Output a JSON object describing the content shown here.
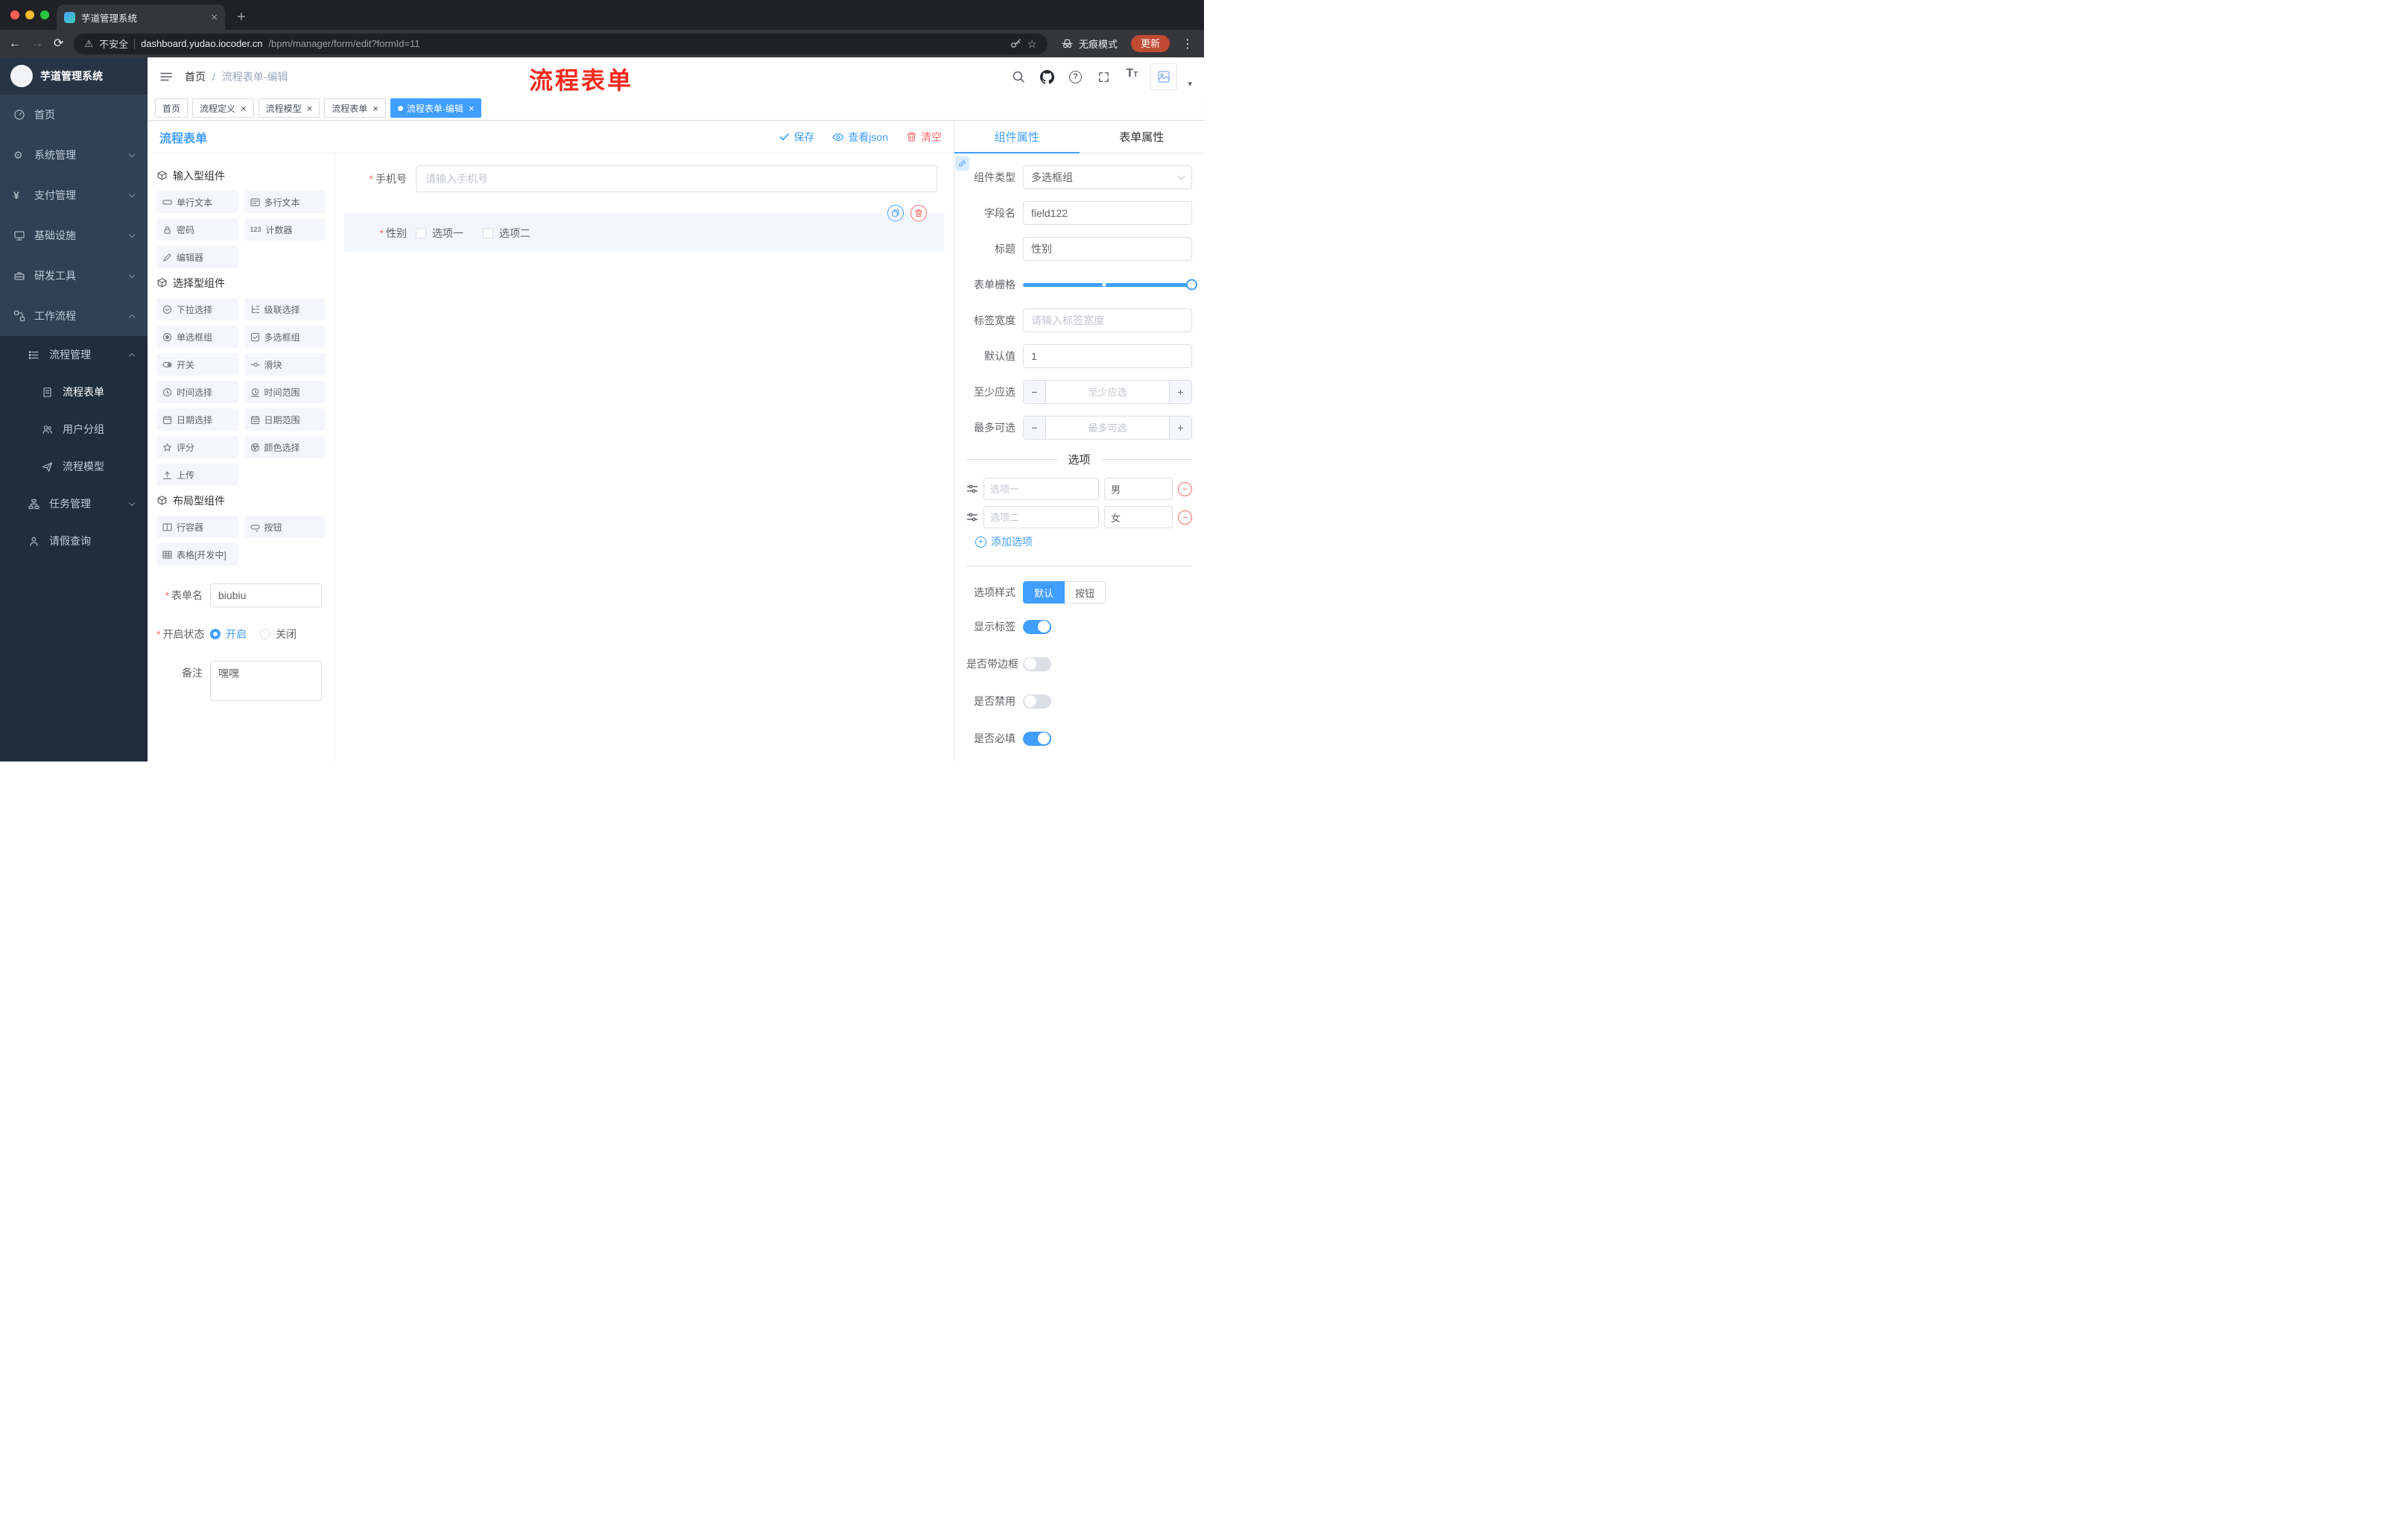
{
  "colors": {
    "accent": "#409eff",
    "danger": "#f56c6c",
    "sidebar_bg": "#304156",
    "sidebar_submenu_bg": "#1f2d3d",
    "active_tag_bg": "#409eff",
    "update_chip_bg": "#bf4932",
    "annotation_red": "#f5291d",
    "selected_widget_bg": "#f4f6fe"
  },
  "icons": {
    "warning": "⚠",
    "star": "☆",
    "kebab": "⋮",
    "gear": "⚙",
    "yen": "¥",
    "plus": "+",
    "close": "×",
    "minus": "−",
    "caret_down": "▾",
    "question": "?",
    "font_big": "T",
    "font_small": "T",
    "counter_123": "123"
  },
  "annotation": {
    "overlay_text": "流程表单"
  },
  "browser": {
    "tab": {
      "title": "芋道管理系统",
      "close": "×",
      "new_tab": "+"
    },
    "nav": {
      "back": "←",
      "forward": "→",
      "reload": "⟳"
    },
    "address": {
      "security": "不安全",
      "host": "dashboard.yudao.iocoder.cn",
      "path": "/bpm/manager/form/edit?formId=11"
    },
    "incognito_label": "无痕模式",
    "update_label": "更新"
  },
  "sidebar": {
    "logo_title": "芋道管理系统",
    "menu": [
      {
        "label": "首页"
      },
      {
        "label": "系统管理"
      },
      {
        "label": "支付管理"
      },
      {
        "label": "基础设施"
      },
      {
        "label": "研发工具"
      },
      {
        "label": "工作流程"
      },
      {
        "label": "流程管理"
      },
      {
        "label": "流程表单"
      },
      {
        "label": "用户分组"
      },
      {
        "label": "流程模型"
      },
      {
        "label": "任务管理"
      },
      {
        "label": "请假查询"
      }
    ]
  },
  "navbar": {
    "breadcrumb_home": "首页",
    "breadcrumb_separator": "/",
    "breadcrumb_current": "流程表单-编辑"
  },
  "tags": [
    {
      "label": "首页",
      "closable": false,
      "active": false
    },
    {
      "label": "流程定义",
      "closable": true,
      "active": false
    },
    {
      "label": "流程模型",
      "closable": true,
      "active": false
    },
    {
      "label": "流程表单",
      "closable": true,
      "active": false
    },
    {
      "label": "流程表单-编辑",
      "closable": true,
      "active": true
    }
  ],
  "editor": {
    "title": "流程表单",
    "actions": {
      "save": "保存",
      "view_json": "查看json",
      "clear": "清空"
    }
  },
  "components": {
    "groups": [
      {
        "title": "输入型组件",
        "items": [
          "单行文本",
          "多行文本",
          "密码",
          "计数器",
          "编辑器"
        ]
      },
      {
        "title": "选择型组件",
        "items": [
          "下拉选择",
          "级联选择",
          "单选框组",
          "多选框组",
          "开关",
          "滑块",
          "时间选择",
          "时间范围",
          "日期选择",
          "日期范围",
          "评分",
          "颜色选择",
          "上传"
        ]
      },
      {
        "title": "布局型组件",
        "items": [
          "行容器",
          "按钮",
          "表格[开发中]"
        ]
      }
    ],
    "meta": {
      "form_name_label": "表单名",
      "form_name_value": "biubiu",
      "status_label": "开启状态",
      "status_on": "开启",
      "status_off": "关闭",
      "status_selected": "开启",
      "remark_label": "备注",
      "remark_value": "嘿嘿"
    }
  },
  "canvas": {
    "phone": {
      "label": "手机号",
      "required": true,
      "placeholder": "请输入手机号"
    },
    "gender": {
      "label": "性别",
      "required": true,
      "selected": true,
      "option1": "选项一",
      "option2": "选项二"
    }
  },
  "props": {
    "tab_component": "组件属性",
    "tab_form": "表单属性",
    "fields": {
      "component_type": {
        "label": "组件类型",
        "value": "多选框组"
      },
      "field_name": {
        "label": "字段名",
        "value": "field122"
      },
      "title": {
        "label": "标题",
        "value": "性别"
      },
      "grid": {
        "label": "表单栅格"
      },
      "label_width": {
        "label": "标签宽度",
        "placeholder": "请输入标签宽度"
      },
      "default_value": {
        "label": "默认值",
        "value": "1"
      },
      "min_select": {
        "label": "至少应选",
        "placeholder": "至少应选"
      },
      "max_select": {
        "label": "最多可选",
        "placeholder": "最多可选"
      }
    },
    "options": {
      "title": "选项",
      "rows": [
        {
          "name_placeholder": "选项一",
          "value": "男"
        },
        {
          "name_placeholder": "选项二",
          "value": "女"
        }
      ],
      "add_label": "添加选项"
    },
    "style": {
      "label": "选项样式",
      "option_default": "默认",
      "option_button": "按钮",
      "active": "默认"
    },
    "toggles": [
      {
        "label": "显示标签",
        "on": true
      },
      {
        "label": "是否带边框",
        "on": false
      },
      {
        "label": "是否禁用",
        "on": false
      },
      {
        "label": "是否必填",
        "on": true
      }
    ]
  }
}
